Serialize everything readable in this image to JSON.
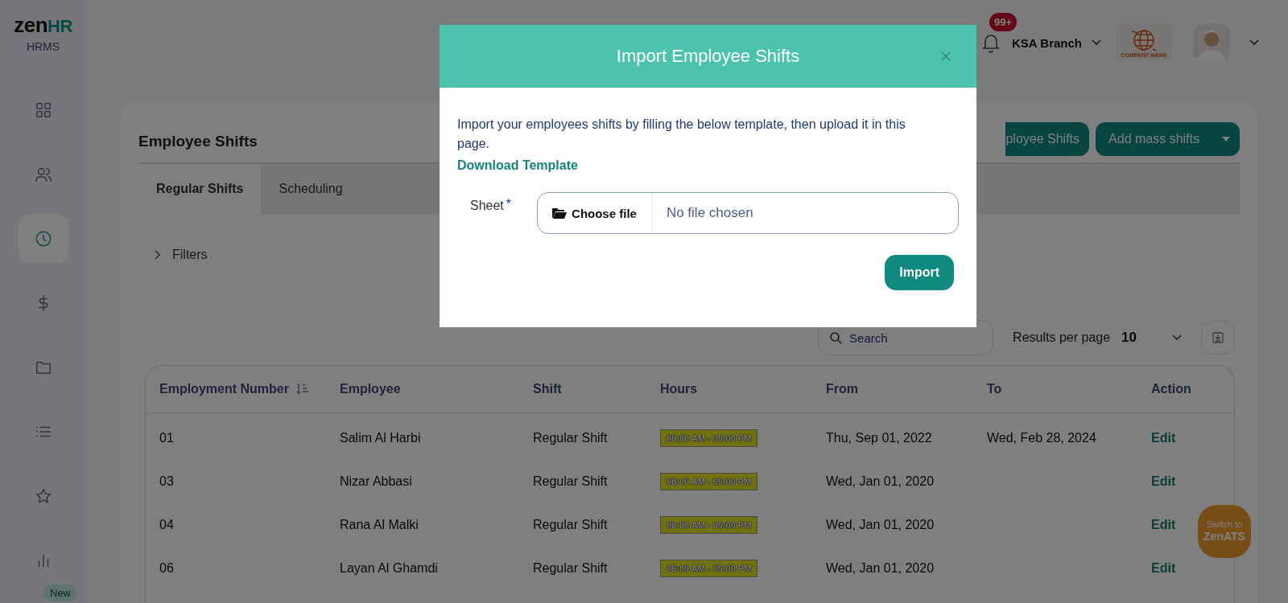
{
  "sidebar": {
    "logo": {
      "brand_a": "zen",
      "brand_b": "HR",
      "product": "HRMS"
    },
    "items": [
      {
        "selected": false
      },
      {
        "selected": false
      },
      {
        "selected": true
      },
      {
        "selected": false
      },
      {
        "selected": false
      },
      {
        "selected": false
      },
      {
        "selected": false
      },
      {
        "selected": false
      }
    ],
    "badge": "New"
  },
  "header": {
    "notifications": "99+",
    "branch": "KSA Branch",
    "company": "COMPANY NAME"
  },
  "page": {
    "title": "Employee Shifts",
    "buttons": [
      {
        "label": "ployee Shifts",
        "kind": "plain"
      },
      {
        "label": "Add mass shifts",
        "kind": "split"
      }
    ],
    "tabs": [
      {
        "label": "Regular Shifts",
        "selected": true
      },
      {
        "label": "Scheduling",
        "selected": false
      }
    ],
    "filters": {
      "label": "Filters",
      "expanded": false
    },
    "search": {
      "placeholder": "Search"
    },
    "results": {
      "label": "Results per page",
      "value": "10"
    },
    "table": {
      "columns": [
        {
          "label": "Employment Number",
          "sorted": true
        },
        {
          "label": "Employee",
          "sorted": false
        },
        {
          "label": "Shift",
          "sorted": false
        },
        {
          "label": "Hours",
          "sorted": false
        },
        {
          "label": "From",
          "sorted": false
        },
        {
          "label": "To",
          "sorted": false
        },
        {
          "label": "Action",
          "sorted": false
        }
      ],
      "rows": [
        {
          "number": "01",
          "employee": "Salim Al Harbi",
          "shift": "Regular Shift",
          "hours": "08:00 AM - 05:00 PM",
          "from": "Thu, Sep 01, 2022",
          "to": "Wed, Feb 28, 2024",
          "action": "Edit"
        },
        {
          "number": "03",
          "employee": "Nizar Abbasi",
          "shift": "Regular Shift",
          "hours": "08:00 AM - 05:00 PM",
          "from": "Wed, Jan 01, 2020",
          "action": "Edit"
        },
        {
          "number": "04",
          "employee": "Rana Al Malki",
          "shift": "Regular Shift",
          "hours": "08:00 AM - 05:00 PM",
          "from": "Wed, Jan 01, 2020",
          "action": "Edit"
        },
        {
          "number": "06",
          "employee": "Layan Al Ghamdi",
          "shift": "Regular Shift",
          "hours": "08:00 AM - 05:00 PM",
          "from": "Wed, Jan 01, 2020",
          "action": "Edit"
        }
      ]
    }
  },
  "switch_button": {
    "line_1": "Switch to",
    "line_2": "ZenATS"
  },
  "modal": {
    "title": "Import Employee Shifts",
    "description": "Import your employees shifts by filling the below template, then upload it in this page.",
    "link": "Download Template",
    "field": {
      "label": "Sheet",
      "required_mark": "*",
      "button": "Choose file",
      "status": "No file chosen"
    },
    "submit": "Import"
  }
}
